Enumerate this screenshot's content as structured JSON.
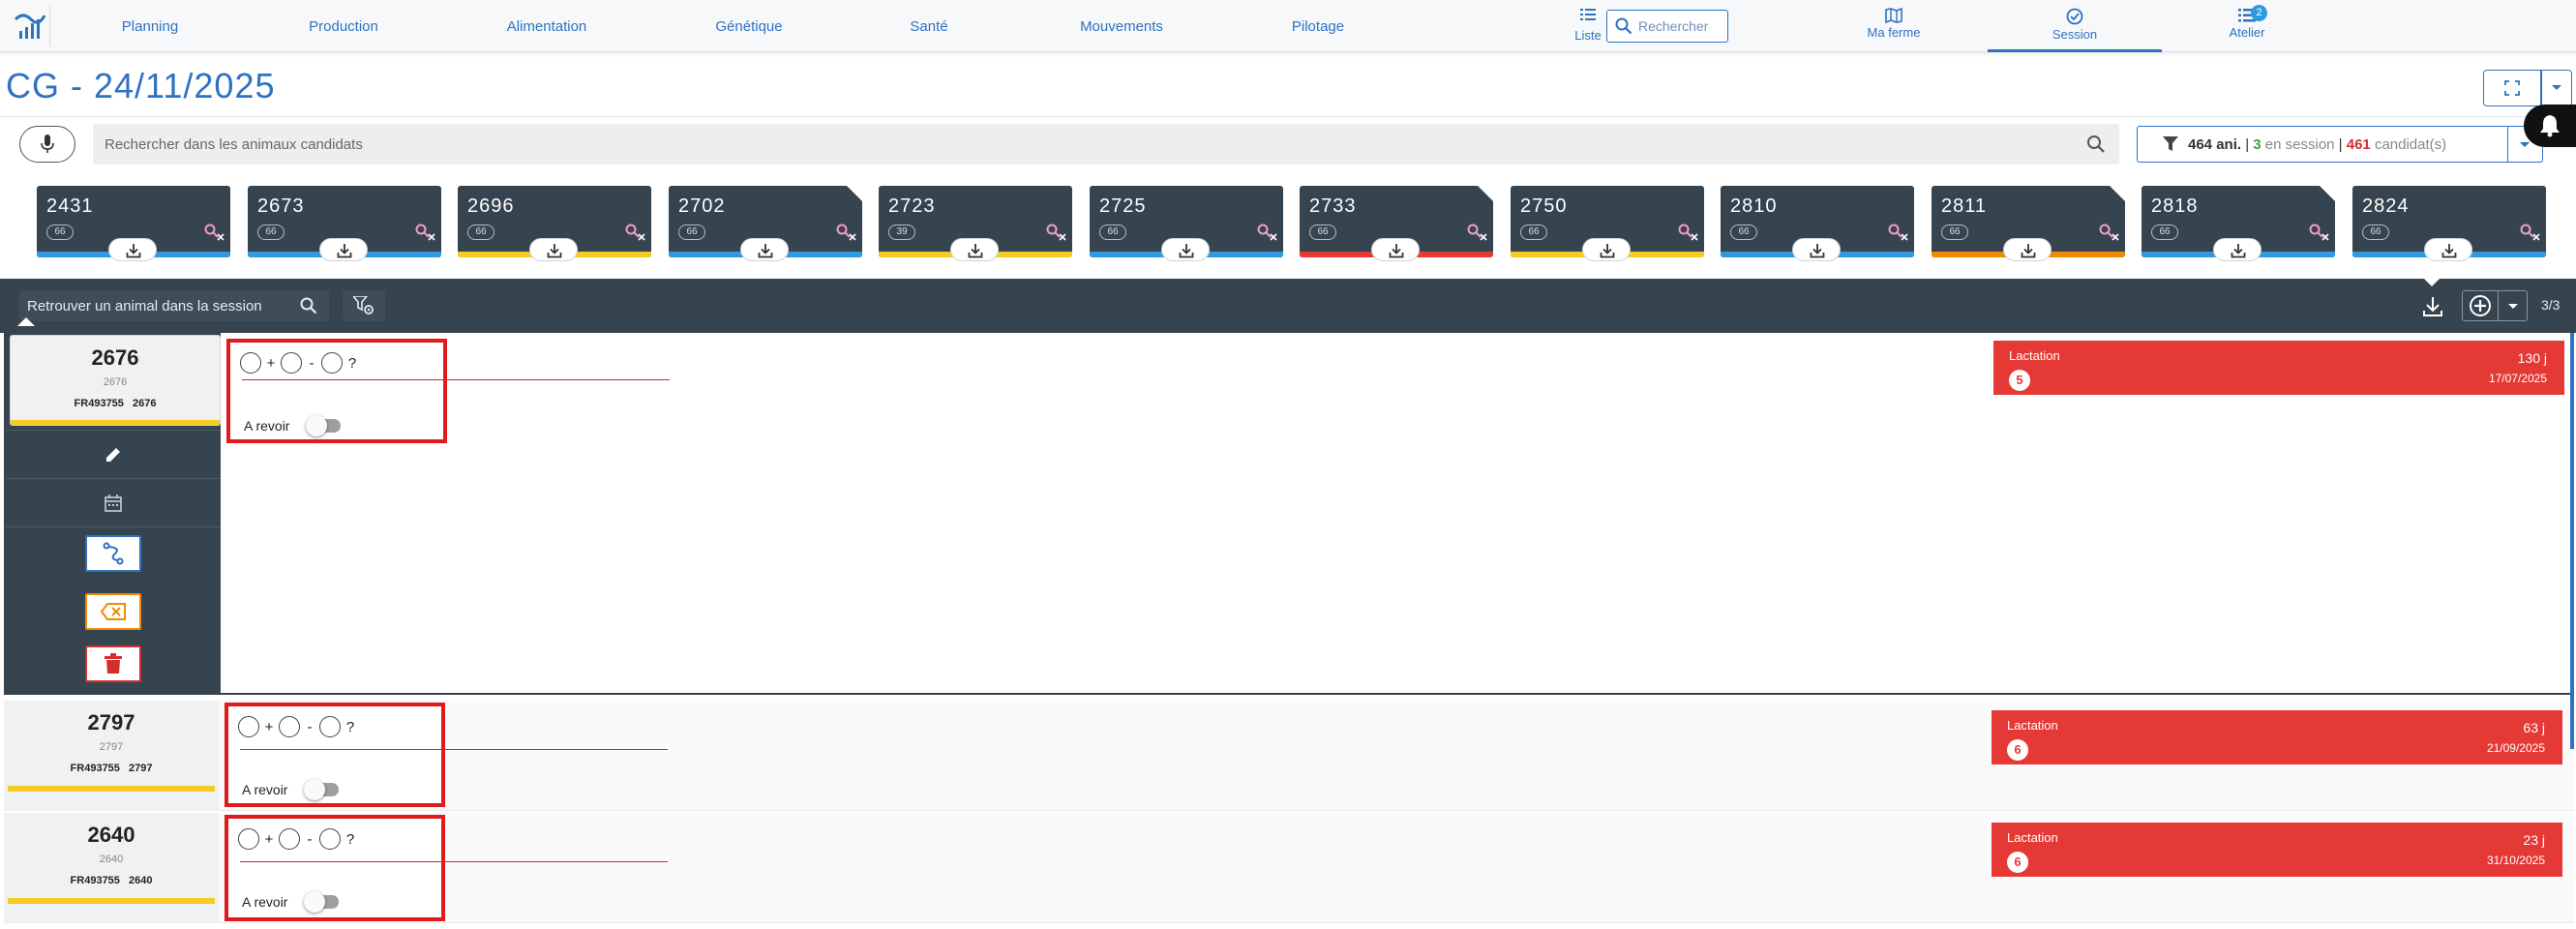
{
  "nav": {
    "items": [
      "Planning",
      "Production",
      "Alimentation",
      "Génétique",
      "Santé",
      "Mouvements",
      "Pilotage"
    ],
    "liste_label": "Liste",
    "search_placeholder": "Rechercher",
    "right_tabs": [
      {
        "label": "Ma ferme",
        "icon": "map-icon"
      },
      {
        "label": "Session",
        "icon": "session-icon",
        "active": true
      },
      {
        "label": "Atelier",
        "icon": "list-icon",
        "badge": "2"
      }
    ]
  },
  "page": {
    "title": "CG - 24/11/2025"
  },
  "candidates": {
    "search_placeholder": "Rechercher dans les animaux candidats",
    "filter": {
      "animals": "464 ani.",
      "sep1": " | ",
      "in_session": "3",
      "in_session_label": " en session ",
      "sep2": " | ",
      "candidates": "461",
      "candidates_label": " candidat(s)"
    },
    "cards": [
      {
        "number": "2431",
        "chip": "66",
        "bar": "#2e9be0",
        "corner": false
      },
      {
        "number": "2673",
        "chip": "66",
        "bar": "#2e9be0",
        "corner": false
      },
      {
        "number": "2696",
        "chip": "66",
        "bar": "#f4cc23",
        "corner": false
      },
      {
        "number": "2702",
        "chip": "66",
        "bar": "#2e9be0",
        "corner": true
      },
      {
        "number": "2723",
        "chip": "39",
        "bar": "#f4cc23",
        "corner": false
      },
      {
        "number": "2725",
        "chip": "66",
        "bar": "#2e9be0",
        "corner": false
      },
      {
        "number": "2733",
        "chip": "66",
        "bar": "#e53935",
        "corner": true
      },
      {
        "number": "2750",
        "chip": "66",
        "bar": "#f4cc23",
        "corner": false
      },
      {
        "number": "2810",
        "chip": "66",
        "bar": "#2e9be0",
        "corner": false
      },
      {
        "number": "2811",
        "chip": "66",
        "bar": "#f08a00",
        "corner": true
      },
      {
        "number": "2818",
        "chip": "66",
        "bar": "#2e9be0",
        "corner": true
      },
      {
        "number": "2824",
        "chip": "66",
        "bar": "#2e9be0",
        "corner": false
      }
    ]
  },
  "session": {
    "search_placeholder": "Retrouver un animal dans la session",
    "counter": "3/3",
    "observation": {
      "plus": "+",
      "minus": "-",
      "unknown": "?",
      "revoir_label": "A revoir"
    },
    "animals": [
      {
        "number": "2676",
        "sub": "2676",
        "reg": "FR493755 2676",
        "lact_label": "Lactation",
        "lact_num": "5",
        "days": "130 j",
        "date": "17/07/2025"
      },
      {
        "number": "2797",
        "sub": "2797",
        "reg": "FR493755 2797",
        "lact_label": "Lactation",
        "lact_num": "6",
        "days": "63 j",
        "date": "21/09/2025"
      },
      {
        "number": "2640",
        "sub": "2640",
        "reg": "FR493755 2640",
        "lact_label": "Lactation",
        "lact_num": "6",
        "days": "23 j",
        "date": "31/10/2025"
      }
    ]
  },
  "colors": {
    "accent": "#2e72c2",
    "dark_panel": "#36444f",
    "alert_red": "#e53935",
    "highlight_red": "#e11a1a",
    "warning_orange": "#f08a00",
    "yellow": "#f4cc23"
  }
}
